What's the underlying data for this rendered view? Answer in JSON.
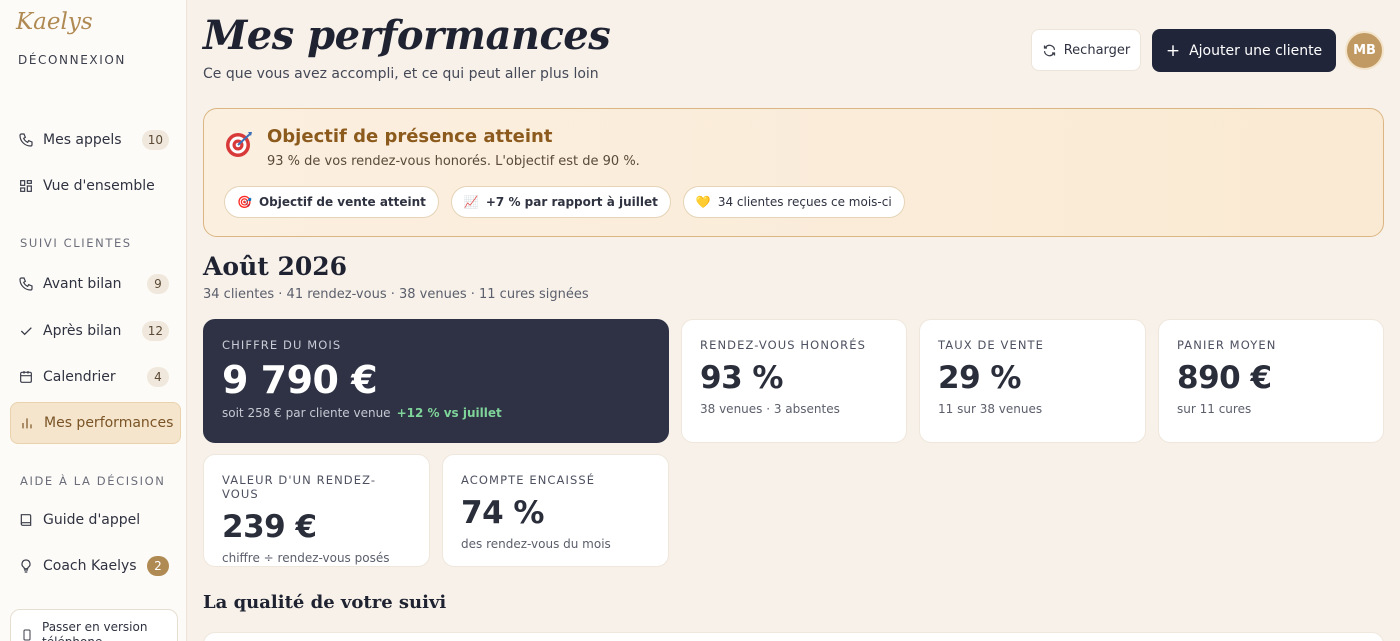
{
  "app": {
    "logo": "Kaelys",
    "logout": "DÉCONNEXION"
  },
  "sidebar": {
    "items_top": [
      {
        "label": "Mes appels",
        "badge": "10"
      },
      {
        "label": "Vue d'ensemble"
      }
    ],
    "section_followup": "SUIVI CLIENTES",
    "items_followup": [
      {
        "label": "Avant bilan",
        "badge": "9"
      },
      {
        "label": "Après bilan",
        "badge": "12"
      },
      {
        "label": "Calendrier",
        "badge": "4"
      },
      {
        "label": "Mes performances",
        "active": true
      }
    ],
    "section_decision": "AIDE À LA DÉCISION",
    "items_decision": [
      {
        "label": "Guide d'appel"
      },
      {
        "label": "Coach Kaelys",
        "badge": "2"
      }
    ],
    "mobile_btn": "Passer en version téléphone"
  },
  "header": {
    "title": "Mes performances",
    "subtitle": "Ce que vous avez accompli, et ce qui peut aller plus loin",
    "reload": "Recharger",
    "add_client": "Ajouter une cliente",
    "avatar_initials": "MB"
  },
  "goal": {
    "title": "Objectif de présence atteint",
    "desc": "93 % de vos rendez-vous honorés. L'objectif est de 90 %.",
    "chips": [
      {
        "emoji": "🎯",
        "text": "Objectif de vente atteint"
      },
      {
        "emoji": "📈",
        "text": "+7 % par rapport à juillet"
      },
      {
        "emoji": "💛",
        "text": "34 clientes reçues ce mois-ci"
      }
    ]
  },
  "month": {
    "title": "Août 2026",
    "summary": "34 clientes · 41 rendez-vous · 38 venues · 11 cures signées"
  },
  "kpis": {
    "revenue": {
      "label": "CHIFFRE DU MOIS",
      "value": "9 790 €",
      "note": "soit 258 € par cliente venue",
      "delta": "+12 % vs juillet"
    },
    "attendance": {
      "label": "RENDEZ-VOUS HONORÉS",
      "value": "93 %",
      "note": "38 venues · 3 absentes"
    },
    "sales_rate": {
      "label": "TAUX DE VENTE",
      "value": "29 %",
      "note": "11 sur 38 venues"
    },
    "basket": {
      "label": "PANIER MOYEN",
      "value": "890 €",
      "note": "sur 11 cures"
    },
    "appointment_value": {
      "label": "VALEUR D'UN RENDEZ-VOUS",
      "value": "239 €",
      "note": "chiffre ÷ rendez-vous posés"
    },
    "deposit": {
      "label": "ACOMPTE ENCAISSÉ",
      "value": "74 %",
      "note": "des rendez-vous du mois"
    }
  },
  "quality": {
    "title": "La qualité de votre suivi"
  },
  "colors": {
    "accent_gold": "#b08a53",
    "dark": "#21253a",
    "positive": "#7fd49a"
  }
}
